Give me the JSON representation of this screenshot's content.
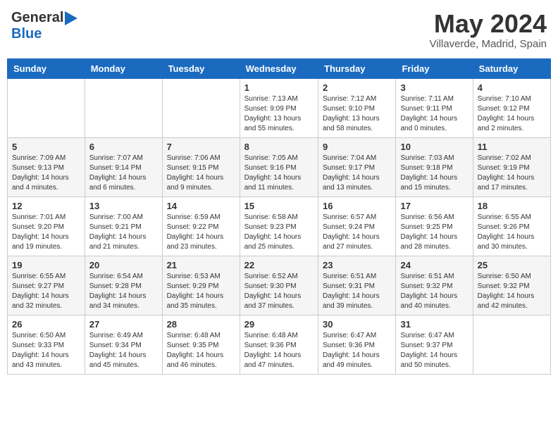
{
  "header": {
    "logo_general": "General",
    "logo_blue": "Blue",
    "month_title": "May 2024",
    "location": "Villaverde, Madrid, Spain"
  },
  "days_of_week": [
    "Sunday",
    "Monday",
    "Tuesday",
    "Wednesday",
    "Thursday",
    "Friday",
    "Saturday"
  ],
  "weeks": [
    [
      {
        "day": "",
        "info": ""
      },
      {
        "day": "",
        "info": ""
      },
      {
        "day": "",
        "info": ""
      },
      {
        "day": "1",
        "info": "Sunrise: 7:13 AM\nSunset: 9:09 PM\nDaylight: 13 hours and 55 minutes."
      },
      {
        "day": "2",
        "info": "Sunrise: 7:12 AM\nSunset: 9:10 PM\nDaylight: 13 hours and 58 minutes."
      },
      {
        "day": "3",
        "info": "Sunrise: 7:11 AM\nSunset: 9:11 PM\nDaylight: 14 hours and 0 minutes."
      },
      {
        "day": "4",
        "info": "Sunrise: 7:10 AM\nSunset: 9:12 PM\nDaylight: 14 hours and 2 minutes."
      }
    ],
    [
      {
        "day": "5",
        "info": "Sunrise: 7:09 AM\nSunset: 9:13 PM\nDaylight: 14 hours and 4 minutes."
      },
      {
        "day": "6",
        "info": "Sunrise: 7:07 AM\nSunset: 9:14 PM\nDaylight: 14 hours and 6 minutes."
      },
      {
        "day": "7",
        "info": "Sunrise: 7:06 AM\nSunset: 9:15 PM\nDaylight: 14 hours and 9 minutes."
      },
      {
        "day": "8",
        "info": "Sunrise: 7:05 AM\nSunset: 9:16 PM\nDaylight: 14 hours and 11 minutes."
      },
      {
        "day": "9",
        "info": "Sunrise: 7:04 AM\nSunset: 9:17 PM\nDaylight: 14 hours and 13 minutes."
      },
      {
        "day": "10",
        "info": "Sunrise: 7:03 AM\nSunset: 9:18 PM\nDaylight: 14 hours and 15 minutes."
      },
      {
        "day": "11",
        "info": "Sunrise: 7:02 AM\nSunset: 9:19 PM\nDaylight: 14 hours and 17 minutes."
      }
    ],
    [
      {
        "day": "12",
        "info": "Sunrise: 7:01 AM\nSunset: 9:20 PM\nDaylight: 14 hours and 19 minutes."
      },
      {
        "day": "13",
        "info": "Sunrise: 7:00 AM\nSunset: 9:21 PM\nDaylight: 14 hours and 21 minutes."
      },
      {
        "day": "14",
        "info": "Sunrise: 6:59 AM\nSunset: 9:22 PM\nDaylight: 14 hours and 23 minutes."
      },
      {
        "day": "15",
        "info": "Sunrise: 6:58 AM\nSunset: 9:23 PM\nDaylight: 14 hours and 25 minutes."
      },
      {
        "day": "16",
        "info": "Sunrise: 6:57 AM\nSunset: 9:24 PM\nDaylight: 14 hours and 27 minutes."
      },
      {
        "day": "17",
        "info": "Sunrise: 6:56 AM\nSunset: 9:25 PM\nDaylight: 14 hours and 28 minutes."
      },
      {
        "day": "18",
        "info": "Sunrise: 6:55 AM\nSunset: 9:26 PM\nDaylight: 14 hours and 30 minutes."
      }
    ],
    [
      {
        "day": "19",
        "info": "Sunrise: 6:55 AM\nSunset: 9:27 PM\nDaylight: 14 hours and 32 minutes."
      },
      {
        "day": "20",
        "info": "Sunrise: 6:54 AM\nSunset: 9:28 PM\nDaylight: 14 hours and 34 minutes."
      },
      {
        "day": "21",
        "info": "Sunrise: 6:53 AM\nSunset: 9:29 PM\nDaylight: 14 hours and 35 minutes."
      },
      {
        "day": "22",
        "info": "Sunrise: 6:52 AM\nSunset: 9:30 PM\nDaylight: 14 hours and 37 minutes."
      },
      {
        "day": "23",
        "info": "Sunrise: 6:51 AM\nSunset: 9:31 PM\nDaylight: 14 hours and 39 minutes."
      },
      {
        "day": "24",
        "info": "Sunrise: 6:51 AM\nSunset: 9:32 PM\nDaylight: 14 hours and 40 minutes."
      },
      {
        "day": "25",
        "info": "Sunrise: 6:50 AM\nSunset: 9:32 PM\nDaylight: 14 hours and 42 minutes."
      }
    ],
    [
      {
        "day": "26",
        "info": "Sunrise: 6:50 AM\nSunset: 9:33 PM\nDaylight: 14 hours and 43 minutes."
      },
      {
        "day": "27",
        "info": "Sunrise: 6:49 AM\nSunset: 9:34 PM\nDaylight: 14 hours and 45 minutes."
      },
      {
        "day": "28",
        "info": "Sunrise: 6:48 AM\nSunset: 9:35 PM\nDaylight: 14 hours and 46 minutes."
      },
      {
        "day": "29",
        "info": "Sunrise: 6:48 AM\nSunset: 9:36 PM\nDaylight: 14 hours and 47 minutes."
      },
      {
        "day": "30",
        "info": "Sunrise: 6:47 AM\nSunset: 9:36 PM\nDaylight: 14 hours and 49 minutes."
      },
      {
        "day": "31",
        "info": "Sunrise: 6:47 AM\nSunset: 9:37 PM\nDaylight: 14 hours and 50 minutes."
      },
      {
        "day": "",
        "info": ""
      }
    ]
  ]
}
